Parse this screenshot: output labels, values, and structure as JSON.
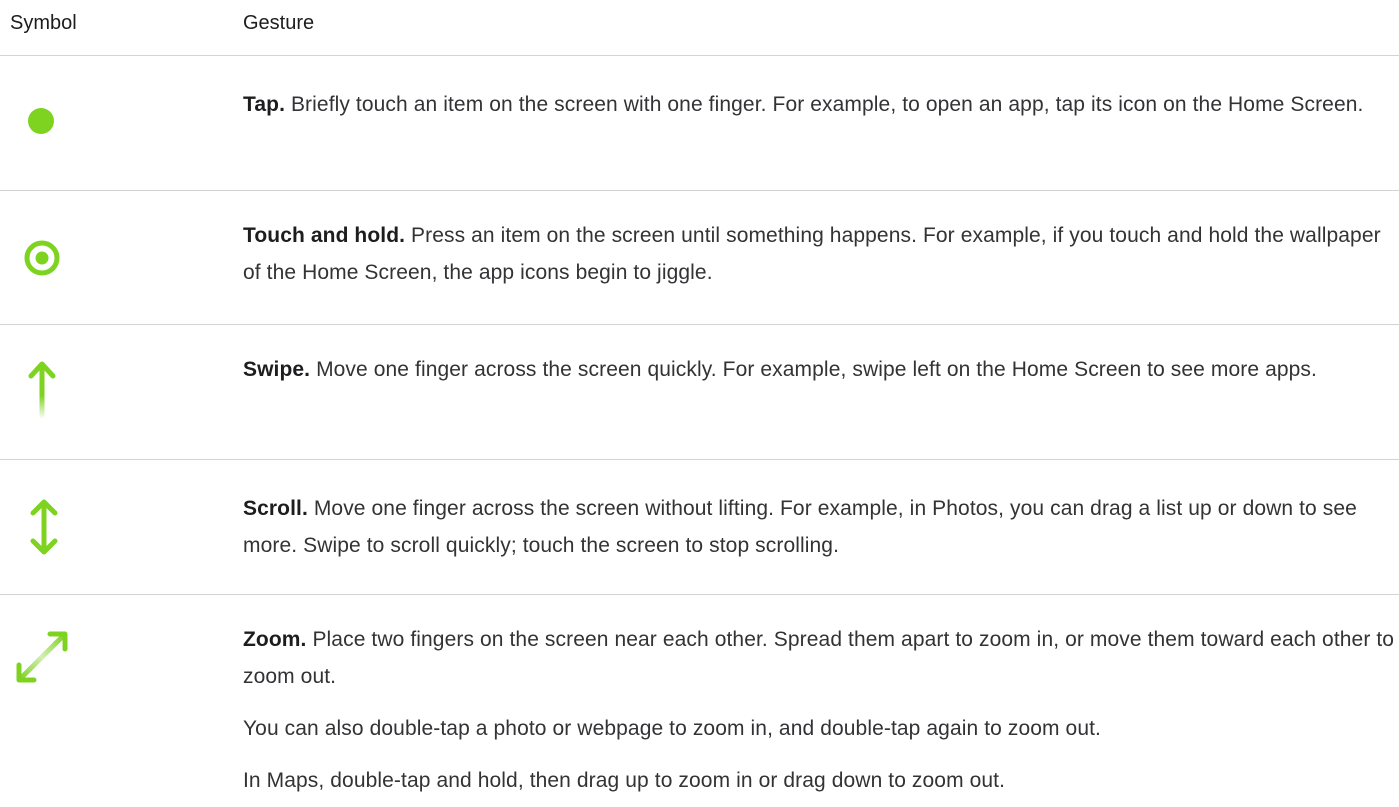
{
  "header": {
    "symbol_label": "Symbol",
    "gesture_label": "Gesture"
  },
  "accent_color": "#7ed321",
  "rows": [
    {
      "icon": "tap-dot-icon",
      "term": "Tap.",
      "paragraphs": [
        "Briefly touch an item on the screen with one finger. For example, to open an app, tap its icon on the Home Screen."
      ]
    },
    {
      "icon": "touch-and-hold-target-icon",
      "term": "Touch and hold.",
      "paragraphs": [
        "Press an item on the screen until something happens. For example, if you touch and hold the wallpaper of the Home Screen, the app icons begin to jiggle."
      ]
    },
    {
      "icon": "swipe-up-arrow-icon",
      "term": "Swipe.",
      "paragraphs": [
        "Move one finger across the screen quickly. For example, swipe left on the Home Screen to see more apps."
      ]
    },
    {
      "icon": "scroll-vertical-arrows-icon",
      "term": "Scroll.",
      "paragraphs": [
        "Move one finger across the screen without lifting. For example, in Photos, you can drag a list up or down to see more. Swipe to scroll quickly; touch the screen to stop scrolling."
      ]
    },
    {
      "icon": "zoom-diagonal-arrows-icon",
      "term": "Zoom.",
      "paragraphs": [
        "Place two fingers on the screen near each other. Spread them apart to zoom in, or move them toward each other to zoom out.",
        "You can also double-tap a photo or webpage to zoom in, and double-tap again to zoom out.",
        "In Maps, double-tap and hold, then drag up to zoom in or drag down to zoom out."
      ]
    }
  ]
}
